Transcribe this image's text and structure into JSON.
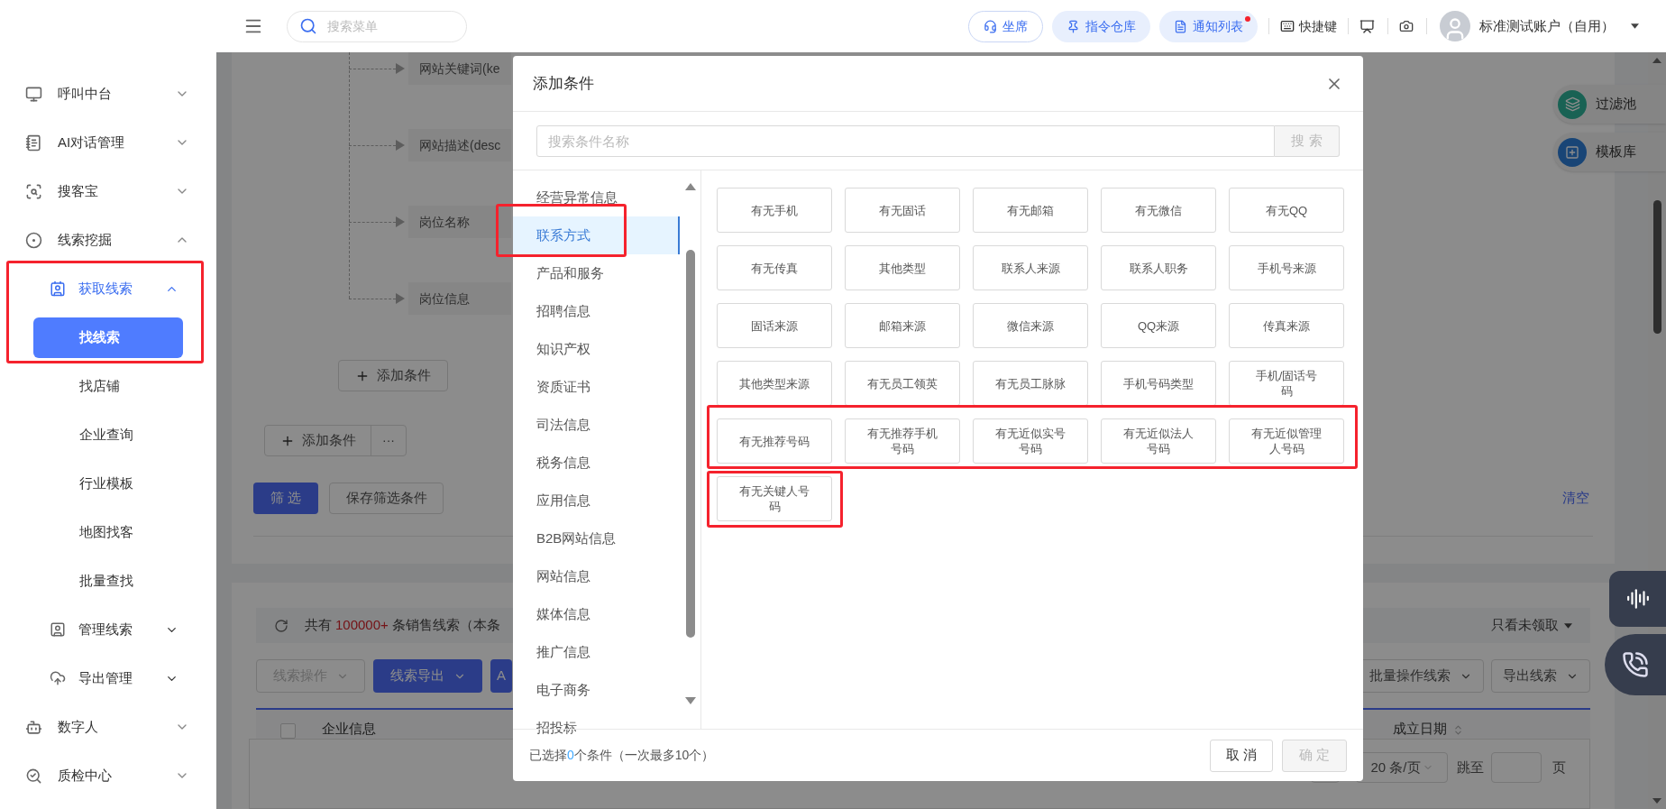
{
  "topbar": {
    "search": {
      "placeholder": "搜索菜单"
    },
    "buttons": [
      {
        "label": "坐席",
        "kind": "outline",
        "badge": false
      },
      {
        "label": "指令仓库",
        "kind": "filled",
        "badge": false
      },
      {
        "label": "通知列表",
        "kind": "filled",
        "badge": true
      }
    ],
    "shortcut": "快捷键",
    "user": "标准测试账户（自用）"
  },
  "sidebar": {
    "items": [
      {
        "label": "呼叫中台",
        "expanded": false
      },
      {
        "label": "AI对话管理",
        "expanded": false
      },
      {
        "label": "搜客宝",
        "expanded": false
      },
      {
        "label": "线索挖掘",
        "expanded": true,
        "children": [
          {
            "label": "获取线索",
            "expanded": true,
            "selected": true,
            "children": [
              {
                "label": "找线索",
                "selected": true
              },
              {
                "label": "找店铺",
                "selected": false
              },
              {
                "label": "企业查询",
                "selected": false
              },
              {
                "label": "行业模板",
                "selected": false
              },
              {
                "label": "地图找客",
                "selected": false
              },
              {
                "label": "批量查找",
                "selected": false
              }
            ]
          },
          {
            "label": "管理线索",
            "expanded": false,
            "selected": false
          },
          {
            "label": "导出管理",
            "expanded": false,
            "selected": false
          }
        ]
      },
      {
        "label": "数字人",
        "expanded": false
      },
      {
        "label": "质检中心",
        "expanded": false
      }
    ]
  },
  "filter_panel": {
    "tree_items": [
      "网站关键词(ke",
      "网站描述(desc",
      "岗位名称",
      "岗位信息"
    ],
    "add_condition": "添加条件",
    "add_condition_group": "添加条件",
    "more": "···",
    "filter_button": "筛 选",
    "save_button": "保存筛选条件",
    "clear_link": "清空"
  },
  "results": {
    "summary": {
      "before": "共有",
      "count": "100000+",
      "after": "条销售线索（本条"
    },
    "unclaimed_filter": "只看未领取",
    "left_actions": [
      {
        "label": "线索操作",
        "kind": "disabled"
      },
      {
        "label": "线索导出",
        "kind": "primary-dropdown"
      },
      {
        "label": "A",
        "kind": "primary"
      }
    ],
    "right_actions": [
      "批量操作线索",
      "导出线索"
    ],
    "table": {
      "checkbox": {
        "checked": false
      },
      "columns": [
        "企业信息",
        "成立日期"
      ]
    },
    "pagination": {
      "page_size": "20 条/页",
      "jump_label": "跳至",
      "page_unit": "页"
    }
  },
  "floating": [
    "过滤池",
    "模板库"
  ],
  "dialog": {
    "title": "添加条件",
    "search": {
      "placeholder": "搜索条件名称",
      "button": "搜 索",
      "disabled": true
    },
    "categories": [
      {
        "label": "经营异常信息",
        "selected": false
      },
      {
        "label": "联系方式",
        "selected": true
      },
      {
        "label": "产品和服务",
        "selected": false
      },
      {
        "label": "招聘信息",
        "selected": false
      },
      {
        "label": "知识产权",
        "selected": false
      },
      {
        "label": "资质证书",
        "selected": false
      },
      {
        "label": "司法信息",
        "selected": false
      },
      {
        "label": "税务信息",
        "selected": false
      },
      {
        "label": "应用信息",
        "selected": false
      },
      {
        "label": "B2B网站信息",
        "selected": false
      },
      {
        "label": "网站信息",
        "selected": false
      },
      {
        "label": "媒体信息",
        "selected": false
      },
      {
        "label": "推广信息",
        "selected": false
      },
      {
        "label": "电子商务",
        "selected": false
      },
      {
        "label": "招投标",
        "selected": false
      }
    ],
    "options": [
      "有无手机",
      "有无固话",
      "有无邮箱",
      "有无微信",
      "有无QQ",
      "有无传真",
      "其他类型",
      "联系人来源",
      "联系人职务",
      "手机号来源",
      "固话来源",
      "邮箱来源",
      "微信来源",
      "QQ来源",
      "传真来源",
      "其他类型来源",
      "有无员工领英",
      "有无员工脉脉",
      "手机号码类型",
      "手机/固话号码",
      "有无推荐号码",
      "有无推荐手机号码",
      "有无近似实号号码",
      "有无近似法人号码",
      "有无近似管理人号码",
      "有无关键人号码"
    ],
    "footer": {
      "before": "已选择",
      "count": "0",
      "after": "个条件（一次最多10个）"
    },
    "cancel": "取 消",
    "confirm": {
      "label": "确 定",
      "disabled": true
    }
  }
}
